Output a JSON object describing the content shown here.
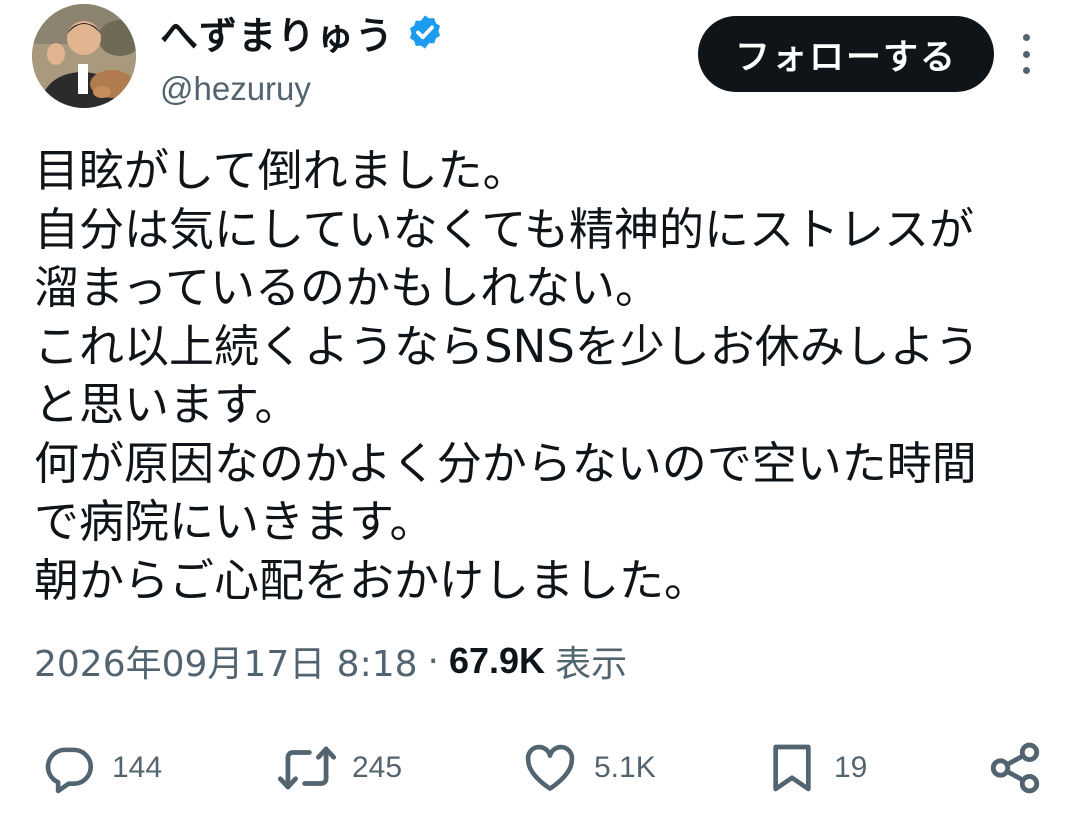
{
  "user": {
    "display_name": "へずまりゅう",
    "handle": "@hezuruy",
    "verified": true,
    "avatar_icon": "user-avatar-photo"
  },
  "follow_button": {
    "label": "フォローする"
  },
  "more_icon": "more-vertical-icon",
  "tweet": {
    "lines": [
      "目眩がして倒れました。",
      "自分は気にしていなくても精神的にストレスが",
      "溜まっているのかもしれない。",
      "これ以上続くようならSNSを少しお休みしよう",
      "と思います。",
      "何が原因なのかよく分からないので空いた時間",
      "で病院にいきます。",
      "朝からご心配をおかけしました。"
    ]
  },
  "meta": {
    "timestamp": "2026年09月17日 8:18",
    "separator": "·",
    "views": "67.9K",
    "views_label": "表示"
  },
  "actions": {
    "reply": {
      "icon": "reply-icon",
      "count": "144"
    },
    "retweet": {
      "icon": "retweet-icon",
      "count": "245"
    },
    "like": {
      "icon": "like-heart-icon",
      "count": "5.1K"
    },
    "bookmark": {
      "icon": "bookmark-icon",
      "count": "19"
    },
    "share": {
      "icon": "share-icon"
    }
  },
  "colors": {
    "text": "#0f1419",
    "secondary": "#536471",
    "verified": "#1d9bf0",
    "button_bg": "#0f1419"
  }
}
